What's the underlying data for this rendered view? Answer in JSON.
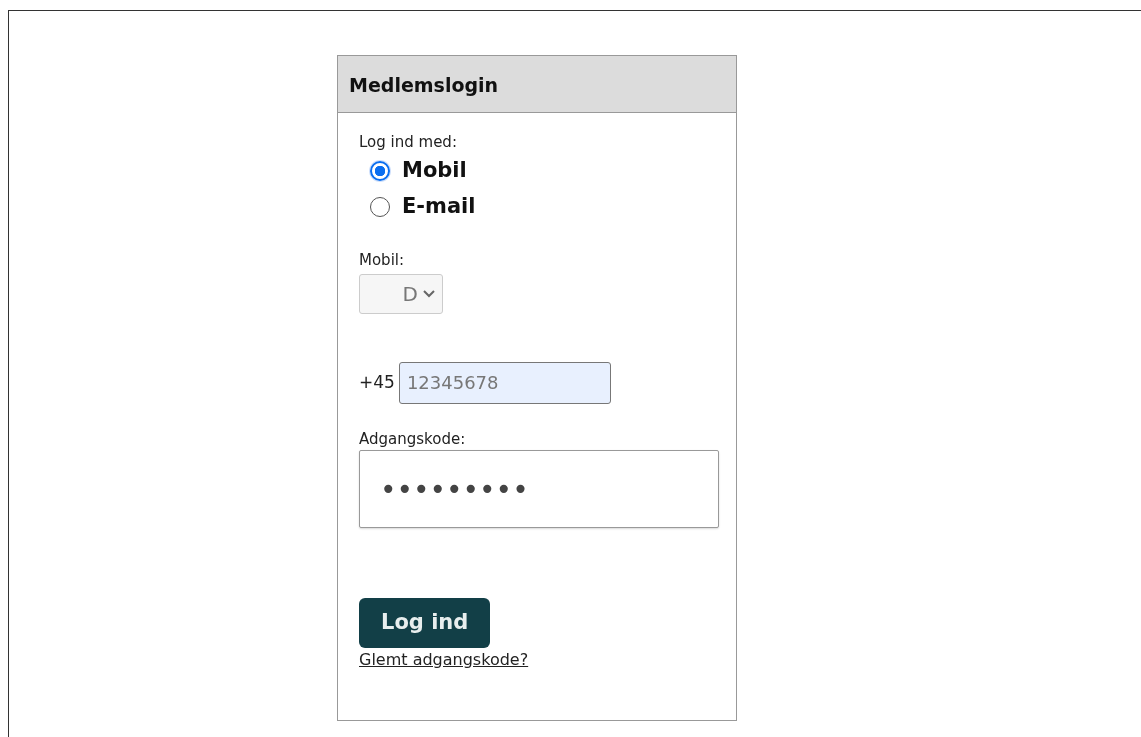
{
  "panel": {
    "title": "Medlemslogin"
  },
  "login_method": {
    "label": "Log ind med:",
    "options": [
      {
        "label": "Mobil",
        "selected": true
      },
      {
        "label": "E-mail",
        "selected": false
      }
    ]
  },
  "mobile": {
    "label": "Mobil:",
    "country_select": {
      "value": "D"
    },
    "prefix": "+45",
    "phone_field": {
      "placeholder": "12345678",
      "autofilled": true
    }
  },
  "password": {
    "label": "Adgangskode:",
    "value": "•••••••••",
    "focused": true
  },
  "login_button": "Log ind",
  "forgot_link": "Glemt adgangskode?"
}
